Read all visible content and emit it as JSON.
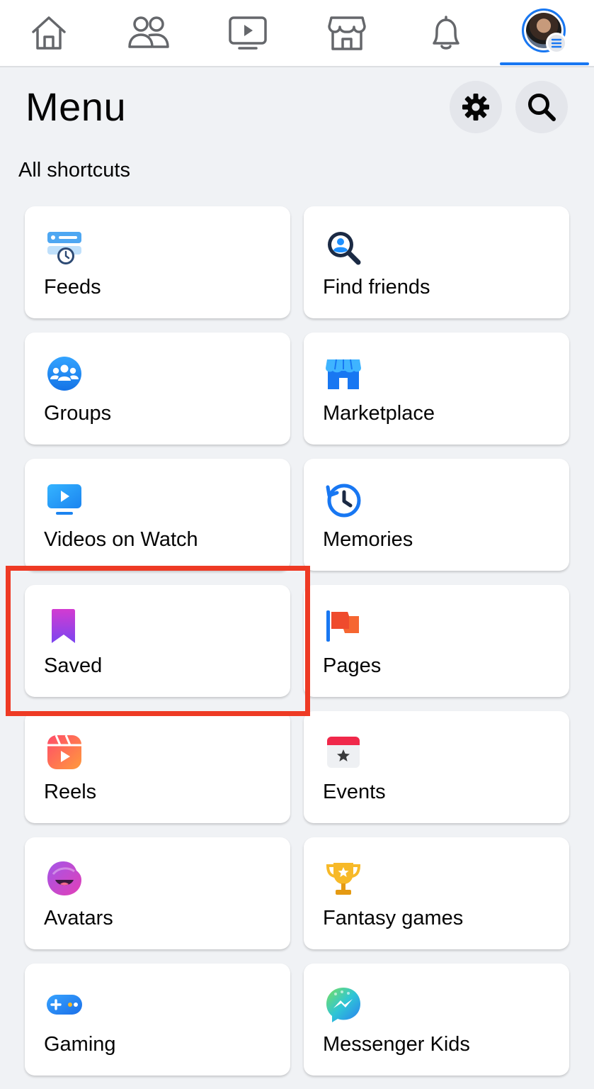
{
  "nav": {
    "tabs": [
      {
        "name": "home-icon",
        "active": false
      },
      {
        "name": "friends-icon",
        "active": false
      },
      {
        "name": "watch-icon",
        "active": false
      },
      {
        "name": "marketplace-icon",
        "active": false
      },
      {
        "name": "notifications-bell-icon",
        "active": false
      },
      {
        "name": "profile-menu-avatar",
        "active": true
      }
    ],
    "accent_color": "#1877f2"
  },
  "header": {
    "title": "Menu",
    "settings_icon": "gear-icon",
    "search_icon": "search-icon"
  },
  "shortcuts": {
    "section_label": "All shortcuts",
    "items": [
      {
        "label": "Feeds",
        "icon": "feeds-icon"
      },
      {
        "label": "Find friends",
        "icon": "find-friends-icon"
      },
      {
        "label": "Groups",
        "icon": "groups-icon"
      },
      {
        "label": "Marketplace",
        "icon": "marketplace-store-icon"
      },
      {
        "label": "Videos on Watch",
        "icon": "video-watch-icon"
      },
      {
        "label": "Memories",
        "icon": "memories-clock-icon"
      },
      {
        "label": "Saved",
        "icon": "saved-bookmark-icon",
        "highlighted": true
      },
      {
        "label": "Pages",
        "icon": "pages-flag-icon"
      },
      {
        "label": "Reels",
        "icon": "reels-icon"
      },
      {
        "label": "Events",
        "icon": "events-calendar-icon"
      },
      {
        "label": "Avatars",
        "icon": "avatars-icon"
      },
      {
        "label": "Fantasy games",
        "icon": "fantasy-trophy-icon"
      },
      {
        "label": "Gaming",
        "icon": "gaming-controller-icon"
      },
      {
        "label": "Messenger Kids",
        "icon": "messenger-kids-icon"
      }
    ]
  },
  "highlight_color": "#ee3a24"
}
